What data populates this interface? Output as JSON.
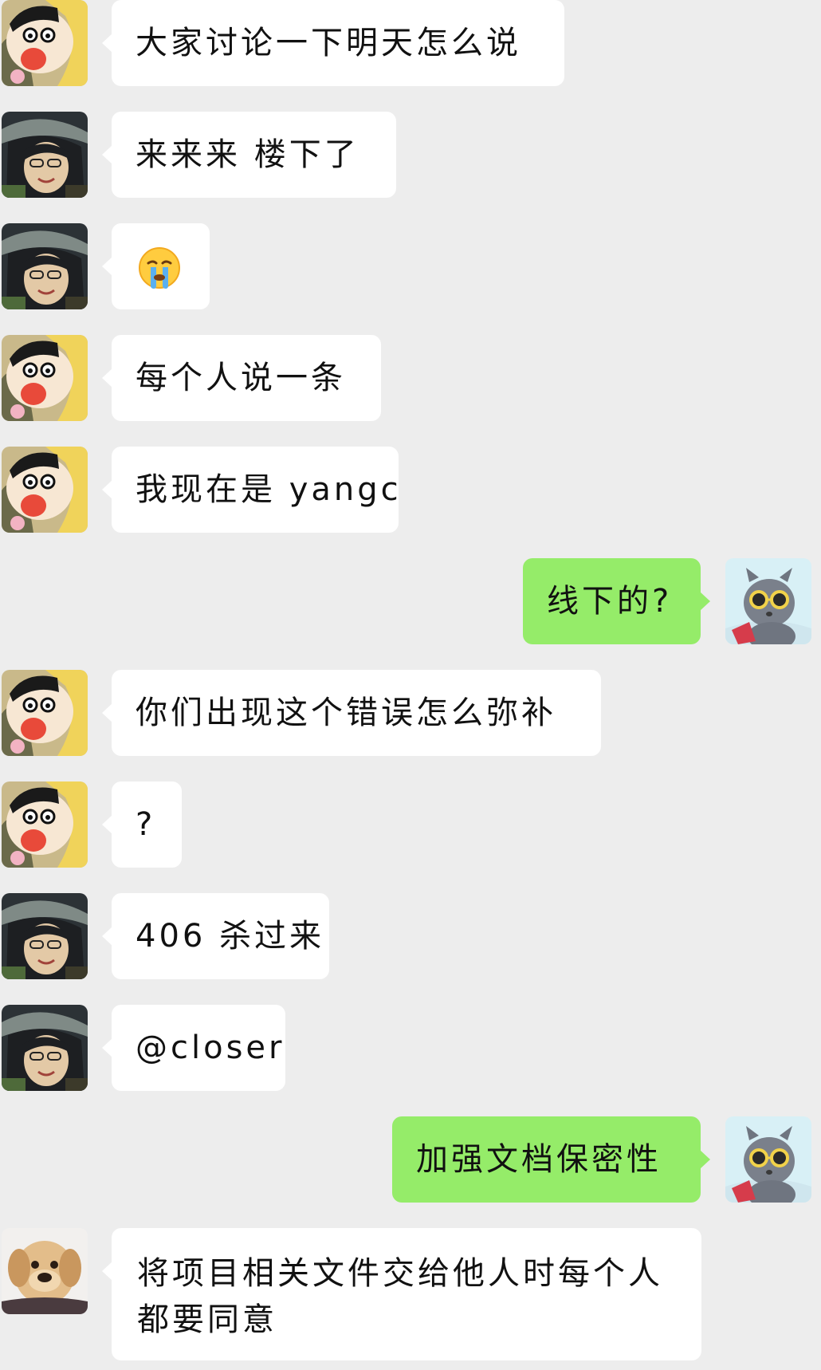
{
  "chat": {
    "messages": [
      {
        "side": "left",
        "avatar": "crayon-shin-chan-avatar",
        "text": "大家讨论一下明天怎么说"
      },
      {
        "side": "left",
        "avatar": "girl-with-hat-avatar",
        "text": "来来来 楼下了"
      },
      {
        "side": "left",
        "avatar": "girl-with-hat-avatar",
        "emoji": "loudly-crying-emoji"
      },
      {
        "side": "left",
        "avatar": "crayon-shin-chan-avatar",
        "text": "每个人说一条"
      },
      {
        "side": "left",
        "avatar": "crayon-shin-chan-avatar",
        "text": "我现在是 yangc"
      },
      {
        "side": "right",
        "avatar": "cat-with-sunglasses-avatar",
        "text": "线下的?"
      },
      {
        "side": "left",
        "avatar": "crayon-shin-chan-avatar",
        "text": "你们出现这个错误怎么弥补"
      },
      {
        "side": "left",
        "avatar": "crayon-shin-chan-avatar",
        "text": "?"
      },
      {
        "side": "left",
        "avatar": "girl-with-hat-avatar",
        "text": "406 杀过来"
      },
      {
        "side": "left",
        "avatar": "girl-with-hat-avatar",
        "text": "@closer"
      },
      {
        "side": "right",
        "avatar": "cat-with-sunglasses-avatar",
        "text": "加强文档保密性"
      },
      {
        "side": "left",
        "avatar": "puppy-avatar",
        "text": "将项目相关文件交给他人时每个人都要同意"
      }
    ]
  },
  "colors": {
    "background": "#ededed",
    "bubble_incoming": "#ffffff",
    "bubble_outgoing": "#95ec69"
  }
}
